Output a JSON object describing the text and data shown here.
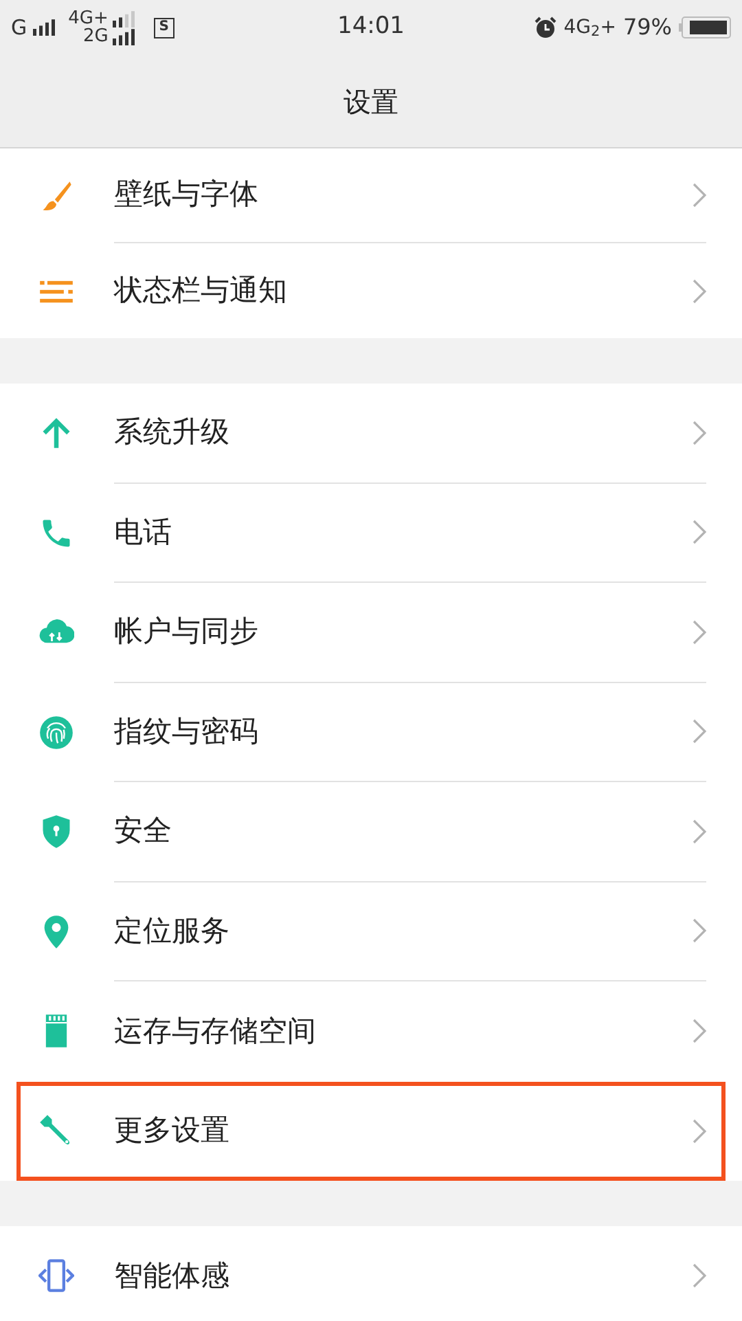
{
  "status_bar": {
    "sim1": "G",
    "sim2_top": "4G+",
    "sim2_bottom": "2G",
    "sim_badge": "S",
    "time": "14:01",
    "network": "4G$_{2}$+",
    "battery": "79%"
  },
  "header": {
    "title": "设置"
  },
  "groups": [
    {
      "items": [
        {
          "label": "壁纸与字体",
          "highlighted": false
        },
        {
          "label": "状态栏与通知",
          "highlighted": false
        }
      ]
    },
    {
      "items": [
        {
          "label": "系统升级",
          "highlighted": false
        },
        {
          "label": "电话",
          "highlighted": false
        },
        {
          "label": "帐户与同步",
          "highlighted": false
        },
        {
          "label": "指纹与密码",
          "highlighted": false
        },
        {
          "label": "安全",
          "highlighted": false
        },
        {
          "label": "定位服务",
          "highlighted": false
        },
        {
          "label": "运存与存储空间",
          "highlighted": false
        },
        {
          "label": "更多设置",
          "highlighted": true
        }
      ]
    },
    {
      "items": [
        {
          "label": "智能体感",
          "highlighted": false
        }
      ]
    }
  ]
}
